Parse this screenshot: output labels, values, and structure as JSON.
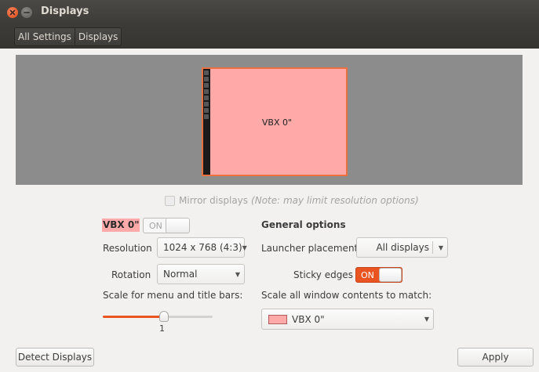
{
  "window": {
    "title": "Displays"
  },
  "breadcrumb": {
    "items": [
      "All Settings",
      "Displays"
    ]
  },
  "monitor": {
    "label": "VBX 0\"",
    "color": "#ffa9a9",
    "border_color": "#e9703f"
  },
  "mirror": {
    "label": "Mirror displays",
    "note": "(Note: may limit resolution options)",
    "checked": false
  },
  "display": {
    "name": "VBX 0\"",
    "power_switch": "ON",
    "power_on": false,
    "resolution_label": "Resolution",
    "resolution_value": "1024 x 768 (4:3)",
    "rotation_label": "Rotation",
    "rotation_value": "Normal",
    "scale_label": "Scale for menu and title bars:",
    "scale_value": "1",
    "scale_fraction": 0.56
  },
  "general": {
    "heading": "General options",
    "launcher_label": "Launcher placement",
    "launcher_value": "All displays",
    "sticky_label": "Sticky edges",
    "sticky_switch": "ON",
    "sticky_on": true,
    "scale_all_label": "Scale all window contents to match:",
    "scale_all_value": "VBX 0\""
  },
  "buttons": {
    "detect": "Detect Displays",
    "apply": "Apply"
  },
  "colors": {
    "accent": "#e95420",
    "display_highlight": "#ffa9a9"
  }
}
